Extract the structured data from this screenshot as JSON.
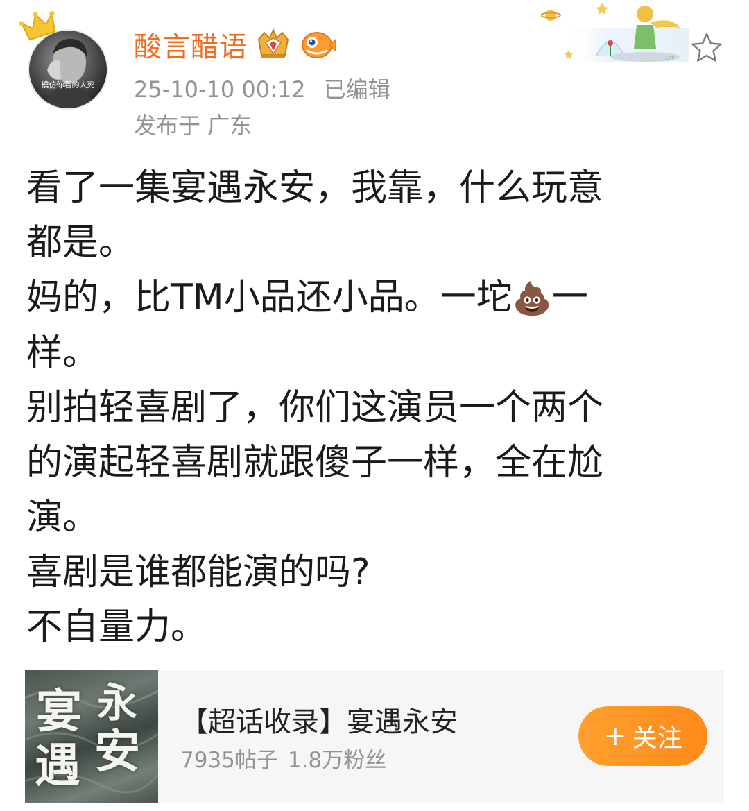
{
  "post": {
    "author": {
      "name": "酸言醋语",
      "avatar_caption": "模仿你看的人死",
      "badges": [
        "crown-gem-badge-icon",
        "puffer-fish-badge-icon"
      ]
    },
    "timestamp": "25-10-10 00:12",
    "edited_label": "已编辑",
    "location": "发布于 广东",
    "body_lines": [
      "看了一集宴遇永安，我靠，什么玩意",
      "都是。",
      "妈的，比TM小品还小品。一坨",
      "样。",
      "别拍轻喜剧了，你们这演员一个两个",
      "的演起轻喜剧就跟傻子一样，全在尬",
      "演。",
      "喜剧是谁都能演的吗?",
      "不自量力。"
    ],
    "inline_emoji": {
      "char": "💩",
      "after_text": "一"
    }
  },
  "topic_card": {
    "cover_chars": [
      "宴",
      "永",
      "遇",
      "安"
    ],
    "title": "【超话收录】宴遇永安",
    "posts": "7935帖子",
    "fans": "1.8万粉丝",
    "follow_plus": "+",
    "follow_label": "关注"
  },
  "colors": {
    "username": "#f26b1f",
    "meta": "#939393",
    "body": "#1a1a1a",
    "card_bg": "#f6f6f6",
    "follow_btn": "#ff8f1f"
  },
  "icons": {
    "favorite": "star-outline-icon",
    "decoration": "little-prince-decoration"
  }
}
